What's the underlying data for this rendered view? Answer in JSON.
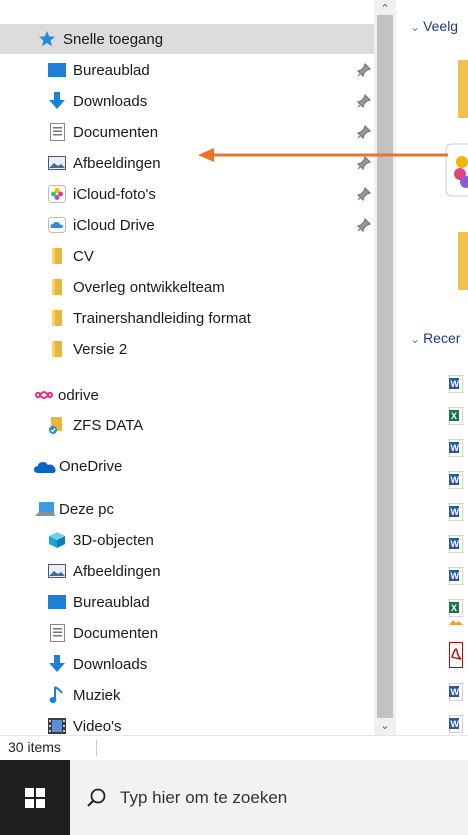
{
  "nav": {
    "quick_access": "Snelle toegang",
    "items": [
      {
        "label": "Bureaublad"
      },
      {
        "label": "Downloads"
      },
      {
        "label": "Documenten"
      },
      {
        "label": "Afbeeldingen"
      },
      {
        "label": "iCloud-foto's"
      },
      {
        "label": "iCloud Drive"
      },
      {
        "label": "CV"
      },
      {
        "label": "Overleg ontwikkelteam"
      },
      {
        "label": "Trainershandleiding format"
      },
      {
        "label": "Versie 2"
      }
    ],
    "odrive": "odrive",
    "zfs": "ZFS DATA",
    "onedrive": "OneDrive",
    "thispc": "Deze pc",
    "pc_items": [
      {
        "label": "3D-objecten"
      },
      {
        "label": "Afbeeldingen"
      },
      {
        "label": "Bureaublad"
      },
      {
        "label": "Documenten"
      },
      {
        "label": "Downloads"
      },
      {
        "label": "Muziek"
      },
      {
        "label": "Video's"
      }
    ]
  },
  "right": {
    "frequent": "Veelg",
    "recent": "Recer"
  },
  "status": {
    "items_count": "30 items"
  },
  "taskbar": {
    "search_placeholder": "Typ hier om te zoeken"
  },
  "colors": {
    "arrow": "#e8732a",
    "selected": "#dcdcdc",
    "taskbar": "#1f1f1f"
  }
}
